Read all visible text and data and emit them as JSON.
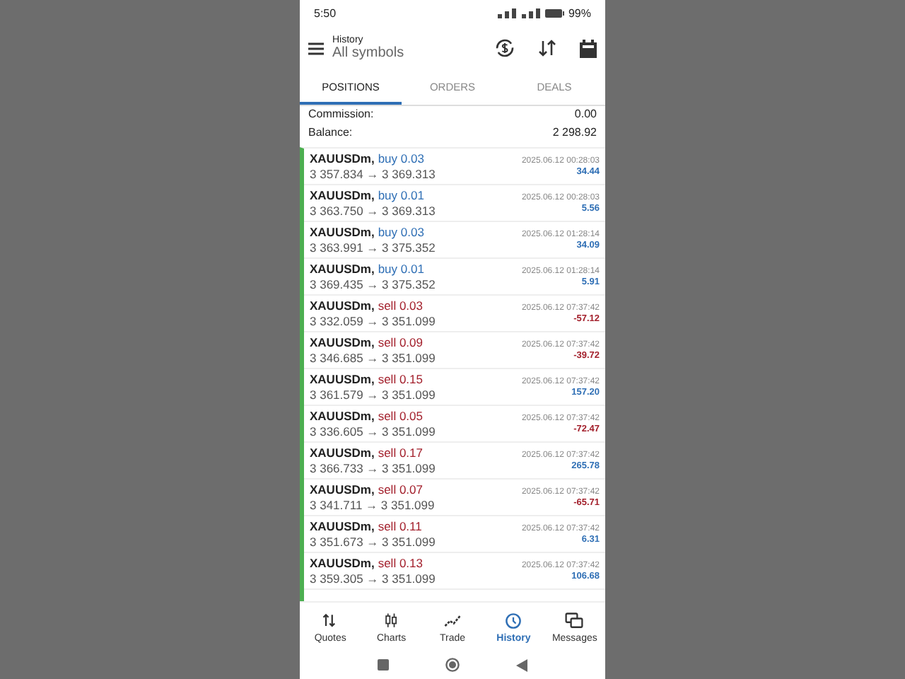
{
  "status_bar": {
    "time": "5:50",
    "battery": "99%"
  },
  "toolbar": {
    "title": "History",
    "subtitle": "All symbols"
  },
  "tabs": [
    {
      "label": "POSITIONS",
      "selected": true
    },
    {
      "label": "ORDERS",
      "selected": false
    },
    {
      "label": "DEALS",
      "selected": false
    }
  ],
  "summary": [
    {
      "label": "Commission:",
      "value": "0.00"
    },
    {
      "label": "Balance:",
      "value": "2 298.92"
    }
  ],
  "positions": [
    {
      "symbol": "XAUUSDm,",
      "kind": "buy",
      "action": "buy 0.03",
      "prices": "3 357.834 → 3 369.313",
      "time": "2025.06.12 00:28:03",
      "profit": "34.44",
      "color": "#2f6fb5"
    },
    {
      "symbol": "XAUUSDm,",
      "kind": "buy",
      "action": "buy 0.01",
      "prices": "3 363.750 → 3 369.313",
      "time": "2025.06.12 00:28:03",
      "profit": "5.56",
      "color": "#2f6fb5"
    },
    {
      "symbol": "XAUUSDm,",
      "kind": "buy",
      "action": "buy 0.03",
      "prices": "3 363.991 → 3 375.352",
      "time": "2025.06.12 01:28:14",
      "profit": "34.09",
      "color": "#2f6fb5"
    },
    {
      "symbol": "XAUUSDm,",
      "kind": "buy",
      "action": "buy 0.01",
      "prices": "3 369.435 → 3 375.352",
      "time": "2025.06.12 01:28:14",
      "profit": "5.91",
      "color": "#2f6fb5"
    },
    {
      "symbol": "XAUUSDm,",
      "kind": "sell",
      "action": "sell 0.03",
      "prices": "3 332.059 → 3 351.099",
      "time": "2025.06.12 07:37:42",
      "profit": "-57.12",
      "color": "#a3202c"
    },
    {
      "symbol": "XAUUSDm,",
      "kind": "sell",
      "action": "sell 0.09",
      "prices": "3 346.685 → 3 351.099",
      "time": "2025.06.12 07:37:42",
      "profit": "-39.72",
      "color": "#a3202c"
    },
    {
      "symbol": "XAUUSDm,",
      "kind": "sell",
      "action": "sell 0.15",
      "prices": "3 361.579 → 3 351.099",
      "time": "2025.06.12 07:37:42",
      "profit": "157.20",
      "color": "#2f6fb5"
    },
    {
      "symbol": "XAUUSDm,",
      "kind": "sell",
      "action": "sell 0.05",
      "prices": "3 336.605 → 3 351.099",
      "time": "2025.06.12 07:37:42",
      "profit": "-72.47",
      "color": "#a3202c"
    },
    {
      "symbol": "XAUUSDm,",
      "kind": "sell",
      "action": "sell 0.17",
      "prices": "3 366.733 → 3 351.099",
      "time": "2025.06.12 07:37:42",
      "profit": "265.78",
      "color": "#2f6fb5"
    },
    {
      "symbol": "XAUUSDm,",
      "kind": "sell",
      "action": "sell 0.07",
      "prices": "3 341.711 → 3 351.099",
      "time": "2025.06.12 07:37:42",
      "profit": "-65.71",
      "color": "#a3202c"
    },
    {
      "symbol": "XAUUSDm,",
      "kind": "sell",
      "action": "sell 0.11",
      "prices": "3 351.673 → 3 351.099",
      "time": "2025.06.12 07:37:42",
      "profit": "6.31",
      "color": "#2f6fb5"
    },
    {
      "symbol": "XAUUSDm,",
      "kind": "sell",
      "action": "sell 0.13",
      "prices": "3 359.305 → 3 351.099",
      "time": "2025.06.12 07:37:42",
      "profit": "106.68",
      "color": "#2f6fb5"
    }
  ],
  "bottom_nav": [
    {
      "label": "Quotes",
      "kind": "quotes",
      "selected": false
    },
    {
      "label": "Charts",
      "kind": "charts",
      "selected": false
    },
    {
      "label": "Trade",
      "kind": "trade",
      "selected": false
    },
    {
      "label": "History",
      "kind": "history",
      "selected": true
    },
    {
      "label": "Messages",
      "kind": "messages",
      "selected": false
    }
  ]
}
